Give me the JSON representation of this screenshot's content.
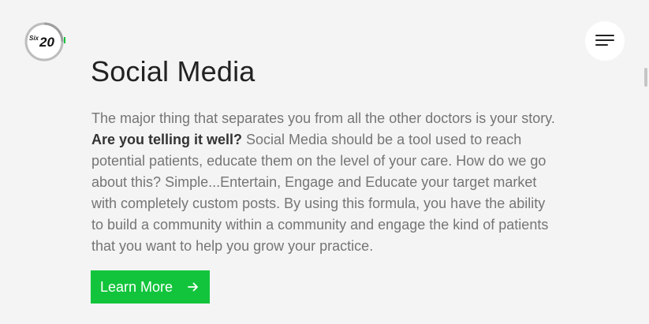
{
  "logo": {
    "small_text": "Six",
    "big_text": "20",
    "accent_color": "#12c43b"
  },
  "menu": {
    "icon": "hamburger-menu-icon"
  },
  "section": {
    "title": "Social Media",
    "paragraph": {
      "line1": "The major thing that separates you from all the other doctors is your story.",
      "line2_bold": "Are you telling it well?",
      "line2_rest": " Social Media should be a tool used to reach",
      "line3": "potential patients, educate them on the level of your care. How do we go",
      "line4": "about this? Simple...Entertain, Engage and Educate your target market",
      "line5": "with completely custom posts. By using this formula, you have the ability",
      "line6": "to build a community within a community and engage the kind of patients",
      "line7": "that you want to help you grow your practice."
    },
    "cta": {
      "label": "Learn More",
      "icon": "arrow-right-icon",
      "color": "#12c43b"
    }
  }
}
